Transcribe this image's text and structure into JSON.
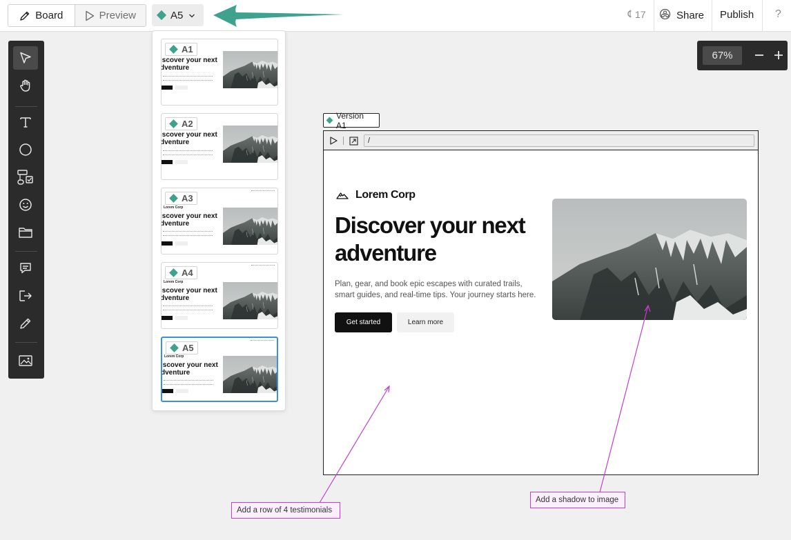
{
  "topbar": {
    "board_label": "Board",
    "preview_label": "Preview",
    "version_selected": "A5",
    "credits": "17",
    "share_label": "Share",
    "publish_label": "Publish",
    "help_label": "?"
  },
  "tools": [
    {
      "name": "select-tool",
      "icon": "cursor-icon",
      "active": true
    },
    {
      "name": "hand-tool",
      "icon": "hand-icon"
    },
    {
      "name": "text-tool",
      "icon": "text-icon"
    },
    {
      "name": "ellipse-tool",
      "icon": "circle-icon"
    },
    {
      "name": "components-tool",
      "icon": "components-icon"
    },
    {
      "name": "emoji-tool",
      "icon": "smiley-icon"
    },
    {
      "name": "folder-tool",
      "icon": "folder-icon"
    },
    {
      "name": "comment-tool",
      "icon": "comment-icon"
    },
    {
      "name": "export-tool",
      "icon": "export-icon"
    },
    {
      "name": "pen-tool",
      "icon": "pencil-icon"
    },
    {
      "name": "image-tool",
      "icon": "image-icon"
    }
  ],
  "versions": [
    {
      "label": "A1",
      "selected": false
    },
    {
      "label": "A2",
      "selected": false
    },
    {
      "label": "A3",
      "selected": false
    },
    {
      "label": "A4",
      "selected": false
    },
    {
      "label": "A5",
      "selected": true
    }
  ],
  "thumbnail": {
    "headline_line1": "iscover your next",
    "headline_line2": "dventure",
    "brand": "Lorem Corp"
  },
  "zoom": {
    "value": "67%"
  },
  "frame": {
    "label": "Version A1",
    "url": "/"
  },
  "site": {
    "brand": "Lorem Corp",
    "headline": "Discover your next adventure",
    "description": "Plan, gear, and book epic escapes with curated trails, smart guides, and real-time tips. Your journey starts here.",
    "primary_cta": "Get started",
    "secondary_cta": "Learn more"
  },
  "annotations": [
    {
      "text": "Add a row of 4 testimonials"
    },
    {
      "text": "Add a shadow to image"
    }
  ],
  "colors": {
    "accent_teal": "#3fa28f",
    "annotation_magenta": "#c13fcf",
    "selection_blue": "#3d8fdc",
    "toolbar_dark": "#2b2b2b"
  }
}
